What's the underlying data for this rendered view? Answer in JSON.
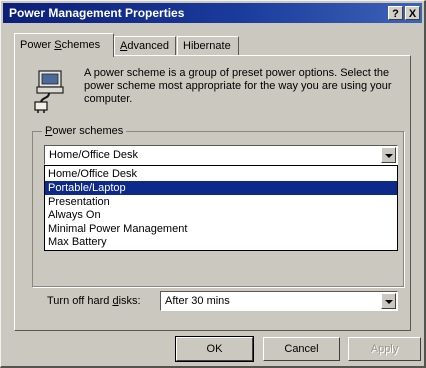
{
  "window": {
    "title": "Power Management Properties",
    "help_glyph": "?",
    "close_glyph": "X"
  },
  "tabs": [
    {
      "label": "Power Schemes",
      "accel": "S",
      "rest": "chemes",
      "prefix": "Power ",
      "active": true
    },
    {
      "label": "Advanced",
      "accel": "A",
      "rest": "dvanced",
      "prefix": "",
      "active": false
    },
    {
      "label": "Hibernate",
      "accel": "",
      "rest": "Hibernate",
      "prefix": "",
      "active": false
    }
  ],
  "description": "A power scheme is a group of preset power options. Select the power scheme most appropriate for the way you are using your computer.",
  "power_schemes": {
    "group_label": "Power schemes",
    "group_label_accel": "P",
    "group_label_rest": "ower schemes",
    "selected_value": "Home/Office Desk",
    "options": [
      "Home/Office Desk",
      "Portable/Laptop",
      "Presentation",
      "Always On",
      "Minimal Power Management",
      "Max Battery"
    ],
    "highlighted_index": 1
  },
  "hard_disks": {
    "label_prefix": "Turn off hard ",
    "label_accel": "d",
    "label_rest": "isks:",
    "value": "After 30 mins"
  },
  "buttons": {
    "ok": "OK",
    "cancel": "Cancel",
    "apply": "Apply"
  },
  "icons": {
    "scheme_icon": "power-plug-computer-icon",
    "dropdown_arrow": "chevron-down-icon"
  },
  "colors": {
    "title_bar": "#0c1f78",
    "selection": "#0d2a8a",
    "face": "#cbc8bf"
  }
}
